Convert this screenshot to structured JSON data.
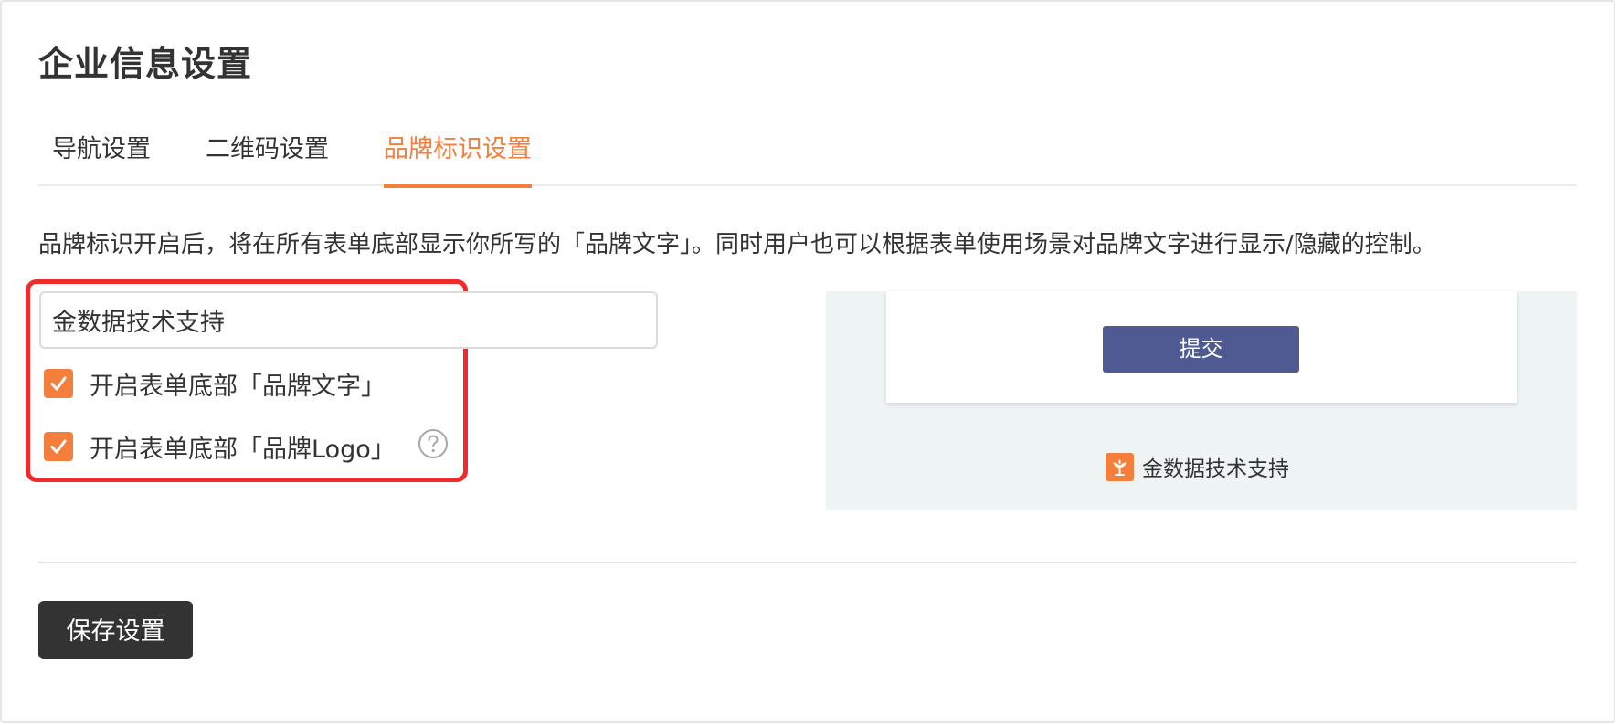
{
  "page": {
    "title": "企业信息设置"
  },
  "tabs": [
    {
      "label": "导航设置",
      "active": false
    },
    {
      "label": "二维码设置",
      "active": false
    },
    {
      "label": "品牌标识设置",
      "active": true
    }
  ],
  "colors": {
    "accent": "#f47f3d",
    "highlight_border": "#f02b2b",
    "submit_button": "#4f5a92",
    "save_button": "#333333",
    "preview_background": "#eef3f4"
  },
  "brand_settings": {
    "description": "品牌标识开启后，将在所有表单底部显示你所写的「品牌文字」。同时用户也可以根据表单使用场景对品牌文字进行显示/隐藏的控制。",
    "brand_text_value": "金数据技术支持",
    "options": [
      {
        "label": "开启表单底部「品牌文字」",
        "checked": true
      },
      {
        "label": "开启表单底部「品牌Logo」",
        "checked": true,
        "help_icon": "question-circle-icon"
      }
    ]
  },
  "preview": {
    "submit_label": "提交",
    "footer_logo_icon": "sprout-logo-icon",
    "footer_text": "金数据技术支持"
  },
  "actions": {
    "save_label": "保存设置"
  }
}
